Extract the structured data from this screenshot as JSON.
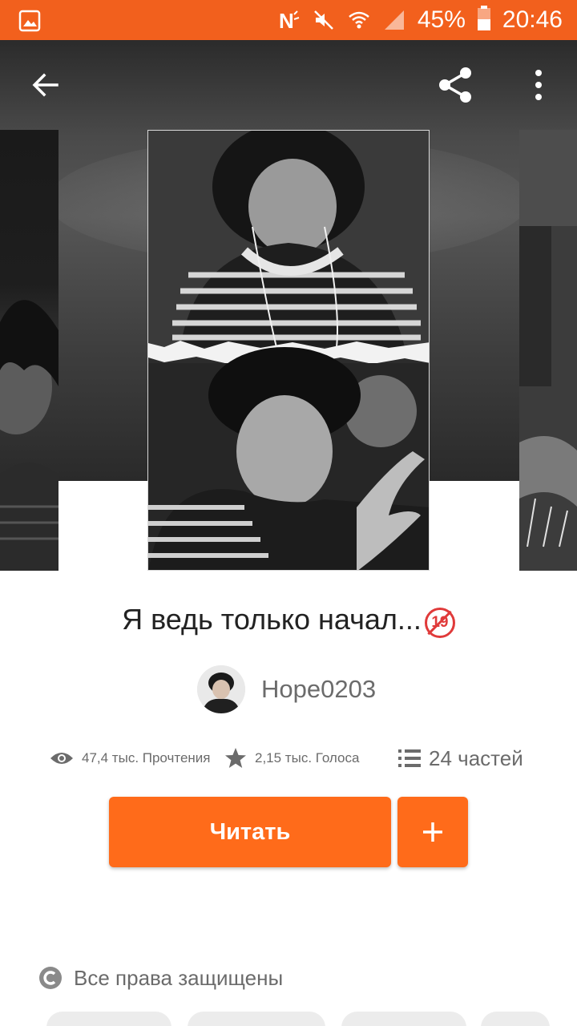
{
  "status_bar": {
    "battery": "45%",
    "time": "20:46",
    "icons": [
      "gallery-icon",
      "nfc-icon",
      "mute-icon",
      "wifi-icon",
      "signal-icon",
      "battery-icon"
    ]
  },
  "toolbar": {
    "icons": [
      "back-arrow-icon",
      "share-icon",
      "more-vert-icon"
    ]
  },
  "story": {
    "title": "Я ведь только начал...",
    "age_badge": "19",
    "author": "Hope0203"
  },
  "stats": {
    "reads": "47,4 тыс. Прочтения",
    "votes": "2,15 тыс. Голоса",
    "parts": "24 частей"
  },
  "actions": {
    "read_label": "Читать",
    "add_label": "+"
  },
  "copyright": "Все права защищены",
  "colors": {
    "accent": "#ff6b1a",
    "status_bar": "#f2601d",
    "text_secondary": "#6b6b6b"
  }
}
